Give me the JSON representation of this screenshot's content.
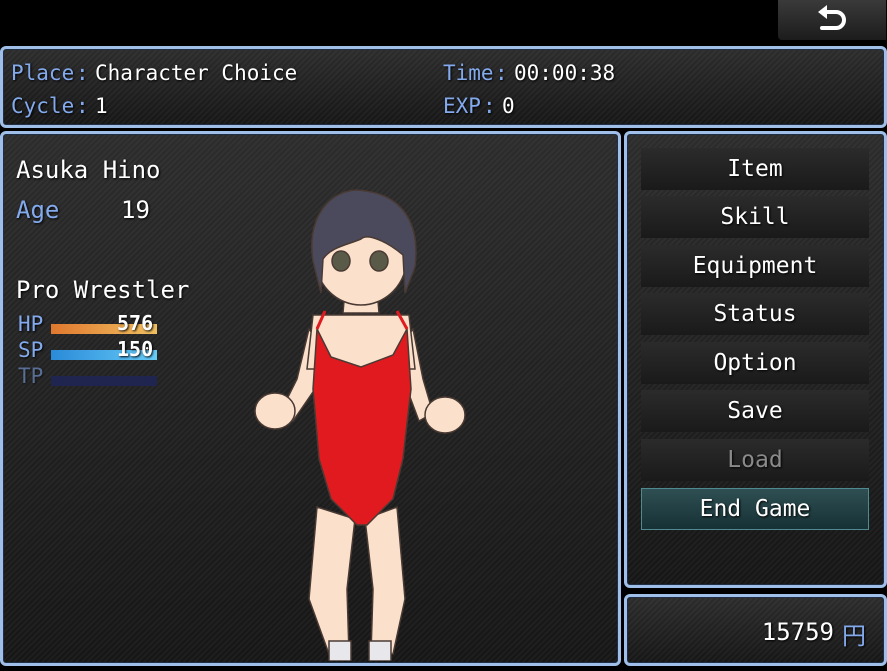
{
  "header": {
    "place_label": "Place",
    "place_value": "Character Choice",
    "time_label": "Time",
    "time_value": "00:00:38",
    "cycle_label": "Cycle",
    "cycle_value": "1",
    "exp_label": "EXP",
    "exp_value": "0",
    "separator": ":"
  },
  "character": {
    "name": "Asuka Hino",
    "age_label": "Age",
    "age_value": "19",
    "class_name": "Pro Wrestler",
    "hp_label": "HP",
    "hp_value": "576",
    "hp_fill_fraction": 1.0,
    "sp_label": "SP",
    "sp_value": "150",
    "sp_fill_fraction": 1.0,
    "tp_label": "TP",
    "tp_fill_fraction": 0.0
  },
  "menu": {
    "items": [
      {
        "label": "Item",
        "state": "enabled"
      },
      {
        "label": "Skill",
        "state": "enabled"
      },
      {
        "label": "Equipment",
        "state": "enabled"
      },
      {
        "label": "Status",
        "state": "enabled"
      },
      {
        "label": "Option",
        "state": "enabled"
      },
      {
        "label": "Save",
        "state": "enabled"
      },
      {
        "label": "Load",
        "state": "disabled"
      },
      {
        "label": "End Game",
        "state": "selected"
      }
    ]
  },
  "gold": {
    "amount": "15759",
    "currency": "円"
  },
  "icons": {
    "back": "return-arrow-icon"
  },
  "colors": {
    "system_text": "#84aaee",
    "window_border": "#9fbfe8",
    "hp_gauge": [
      "#e0782e",
      "#f0c060"
    ],
    "sp_gauge": [
      "#2a8ad8",
      "#66ccf8"
    ],
    "gauge_back": "#20254f",
    "selected_command": "#2f5054"
  }
}
